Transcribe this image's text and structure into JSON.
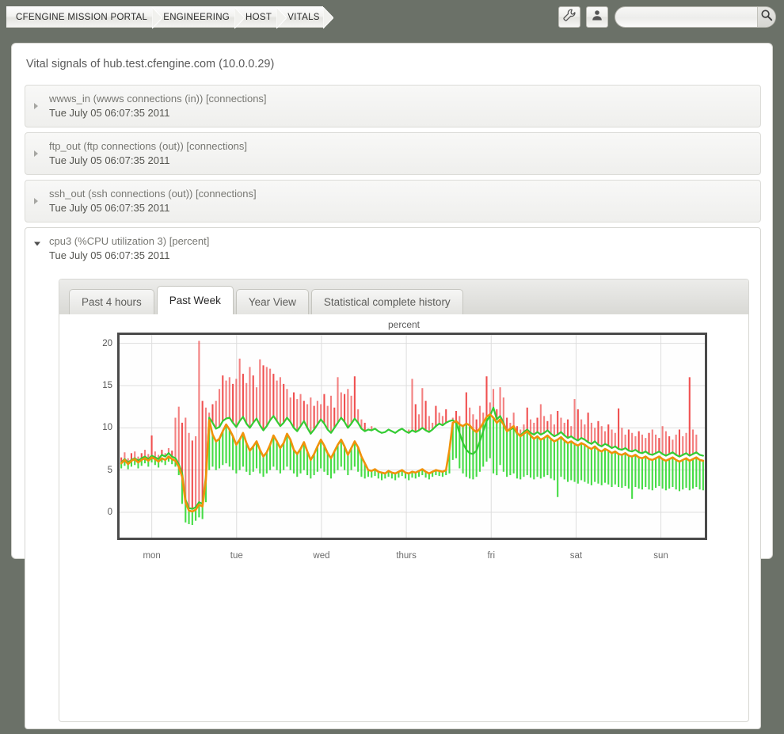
{
  "topbar": {
    "breadcrumb": [
      {
        "label": "CFENGINE MISSION PORTAL"
      },
      {
        "label": "ENGINEERING"
      },
      {
        "label": "HOST"
      },
      {
        "label": "VITALS"
      }
    ],
    "wrench_icon": "wrench-icon",
    "user_icon": "user-icon",
    "search": {
      "value": "",
      "placeholder": "",
      "button_icon": "search-icon"
    }
  },
  "panel": {
    "title": "Vital signals of hub.test.cfengine.com (10.0.0.29)"
  },
  "signals": [
    {
      "name": "wwws_in (wwws connections (in)) [connections]",
      "timestamp": "Tue July 05 06:07:35 2011",
      "expanded": false
    },
    {
      "name": "ftp_out (ftp connections (out)) [connections]",
      "timestamp": "Tue July 05 06:07:35 2011",
      "expanded": false
    },
    {
      "name": "ssh_out (ssh connections (out)) [connections]",
      "timestamp": "Tue July 05 06:07:35 2011",
      "expanded": false
    },
    {
      "name": "cpu3 (%CPU utilization 3) [percent]",
      "timestamp": "Tue July 05 06:07:35 2011",
      "expanded": true
    }
  ],
  "tabs": [
    {
      "label": "Past 4 hours",
      "active": false
    },
    {
      "label": "Past Week",
      "active": true
    },
    {
      "label": "Year View",
      "active": false
    },
    {
      "label": "Statistical complete history",
      "active": false
    }
  ],
  "colors": {
    "background": "#6b7168",
    "panel": "#ffffff",
    "line_value": "#f0920a",
    "line_upper": "#33cc33",
    "bar_max": "#f05050",
    "bar_min": "#3ddb3d",
    "plot_border": "#4a4a4a",
    "grid": "#dddddd"
  },
  "chart_data": {
    "type": "line",
    "title": "percent",
    "xlabel": "",
    "ylabel": "percent",
    "ylim": [
      -3,
      21
    ],
    "yticks": [
      0,
      5,
      10,
      15,
      20
    ],
    "grid": true,
    "legend": "none",
    "xticks": [
      "mon",
      "tue",
      "wed",
      "thurs",
      "fri",
      "sat",
      "sun"
    ],
    "xtick_positions": [
      0.055,
      0.2,
      0.345,
      0.49,
      0.635,
      0.78,
      0.925
    ],
    "n_points": 168,
    "series": [
      {
        "name": "value",
        "color": "#f0920a",
        "style": "line",
        "values": [
          5.8,
          6.2,
          5.7,
          6.1,
          6.3,
          5.9,
          6.2,
          6.4,
          6.1,
          6.5,
          6.3,
          6.0,
          6.4,
          6.2,
          6.6,
          6.3,
          6.1,
          5.4,
          4.2,
          1.2,
          0.2,
          0.1,
          0.3,
          0.9,
          0.7,
          3.8,
          10.9,
          9.2,
          8.4,
          8.7,
          9.6,
          10.4,
          9.8,
          9.0,
          8.0,
          8.6,
          9.4,
          8.2,
          7.3,
          7.8,
          8.4,
          7.4,
          6.6,
          7.1,
          8.0,
          9.1,
          8.4,
          7.6,
          8.2,
          9.3,
          8.6,
          7.4,
          6.9,
          7.5,
          8.3,
          7.2,
          6.2,
          6.9,
          7.8,
          8.6,
          7.9,
          7.0,
          6.4,
          7.2,
          8.0,
          8.6,
          7.8,
          6.8,
          7.6,
          8.4,
          7.7,
          6.6,
          5.8,
          5.0,
          4.9,
          5.1,
          4.8,
          4.7,
          4.6,
          4.9,
          4.7,
          4.6,
          4.8,
          5.0,
          4.7,
          4.6,
          4.8,
          4.7,
          4.9,
          5.1,
          4.8,
          4.6,
          4.8,
          5.0,
          4.9,
          4.8,
          5.0,
          7.4,
          10.6,
          10.8,
          10.4,
          10.2,
          10.5,
          10.3,
          9.8,
          9.5,
          9.9,
          10.6,
          11.3,
          11.6,
          11.2,
          10.6,
          11.0,
          10.4,
          9.6,
          9.9,
          10.2,
          9.4,
          9.0,
          9.3,
          9.6,
          9.1,
          8.7,
          9.0,
          8.6,
          8.8,
          9.1,
          8.7,
          8.4,
          8.6,
          8.9,
          8.5,
          8.2,
          8.4,
          8.1,
          7.9,
          8.2,
          8.0,
          7.7,
          7.5,
          7.8,
          7.4,
          7.2,
          7.5,
          7.3,
          7.0,
          7.2,
          6.9,
          6.8,
          7.0,
          6.7,
          6.6,
          6.8,
          6.5,
          6.4,
          6.6,
          6.3,
          6.2,
          6.4,
          6.6,
          6.3,
          6.1,
          6.3,
          6.5,
          6.2,
          6.0,
          6.2,
          6.4,
          6.1,
          6.3,
          6.5,
          6.2,
          6.1
        ],
        "note": "orange actual value line"
      },
      {
        "name": "upper_envelope",
        "color": "#33cc33",
        "style": "line",
        "values": [
          5.9,
          6.3,
          5.9,
          6.2,
          6.4,
          6.1,
          6.4,
          6.6,
          6.3,
          6.7,
          6.5,
          6.3,
          6.8,
          6.6,
          7.0,
          6.6,
          6.4,
          5.7,
          4.6,
          1.5,
          0.5,
          0.4,
          0.6,
          1.2,
          1.0,
          4.2,
          11.2,
          10.6,
          9.9,
          10.1,
          10.8,
          11.1,
          11.2,
          10.6,
          10.1,
          10.8,
          11.3,
          10.5,
          10.0,
          10.6,
          11.1,
          10.3,
          9.7,
          10.2,
          10.9,
          11.4,
          10.8,
          10.2,
          10.6,
          11.2,
          10.7,
          10.0,
          9.6,
          10.2,
          10.8,
          10.0,
          9.3,
          9.8,
          10.4,
          11.0,
          10.5,
          9.8,
          9.4,
          10.0,
          10.6,
          11.2,
          10.7,
          10.0,
          10.5,
          11.1,
          10.6,
          9.9,
          9.6,
          9.8,
          9.7,
          9.9,
          9.6,
          9.4,
          9.5,
          9.8,
          9.6,
          9.4,
          9.7,
          9.9,
          9.6,
          9.4,
          9.7,
          9.5,
          9.7,
          10.0,
          9.7,
          9.5,
          9.8,
          10.2,
          10.5,
          10.3,
          10.6,
          10.8,
          10.9,
          10.6,
          9.4,
          8.2,
          7.4,
          7.0,
          6.9,
          7.3,
          8.4,
          9.6,
          10.8,
          11.4,
          12.4,
          11.0,
          11.4,
          10.6,
          9.6,
          9.8,
          10.0,
          9.3,
          9.1,
          9.5,
          9.8,
          9.4,
          9.2,
          9.5,
          9.2,
          9.4,
          9.7,
          9.3,
          9.0,
          9.2,
          9.5,
          9.1,
          8.8,
          9.0,
          8.7,
          8.5,
          8.8,
          8.6,
          8.3,
          8.1,
          8.4,
          8.0,
          7.8,
          8.1,
          7.9,
          7.6,
          7.8,
          7.5,
          7.4,
          7.6,
          7.3,
          7.2,
          7.4,
          7.1,
          7.0,
          7.2,
          6.9,
          6.8,
          7.0,
          7.2,
          6.9,
          6.7,
          6.9,
          7.1,
          6.8,
          6.6,
          6.8,
          7.0,
          6.7,
          6.9,
          7.1,
          6.8,
          6.7
        ],
        "note": "green upper envelope line"
      },
      {
        "name": "max_bars",
        "color": "#f05050",
        "style": "vertical-bar",
        "values": [
          6.5,
          7.1,
          6.4,
          7.0,
          7.2,
          6.6,
          7.0,
          7.4,
          6.9,
          9.1,
          7.2,
          6.8,
          7.4,
          7.0,
          7.6,
          7.3,
          11.2,
          12.5,
          10.6,
          11.2,
          9.4,
          8.5,
          9.0,
          20.3,
          13.2,
          12.4,
          11.8,
          12.8,
          13.2,
          14.6,
          16.2,
          15.6,
          16.0,
          15.2,
          15.8,
          18.2,
          16.4,
          15.3,
          17.2,
          16.2,
          14.8,
          18.1,
          17.4,
          17.2,
          17.0,
          16.4,
          15.6,
          16.0,
          15.2,
          14.6,
          13.6,
          14.2,
          13.4,
          14.0,
          13.2,
          12.8,
          13.6,
          12.6,
          13.2,
          12.8,
          14.0,
          12.6,
          13.8,
          12.4,
          16.0,
          14.2,
          14.0,
          14.6,
          13.8,
          16.1,
          12.2,
          11.0,
          10.6,
          9.8,
          10.2,
          9.4,
          8.6,
          9.2,
          8.4,
          9.6,
          9.0,
          8.2,
          8.8,
          9.4,
          8.6,
          9.8,
          15.8,
          12.8,
          11.6,
          14.7,
          13.2,
          11.4,
          10.6,
          12.6,
          11.8,
          11.4,
          12.2,
          10.8,
          11.2,
          12.0,
          11.4,
          10.2,
          14.2,
          12.4,
          11.6,
          11.0,
          12.6,
          11.8,
          16.1,
          13.0,
          14.6,
          12.2,
          14.8,
          13.6,
          11.2,
          10.6,
          11.8,
          10.2,
          9.8,
          10.4,
          12.4,
          11.0,
          10.6,
          11.2,
          12.8,
          11.4,
          10.8,
          11.6,
          10.4,
          12.0,
          11.2,
          10.6,
          11.0,
          10.2,
          13.4,
          12.2,
          11.0,
          10.4,
          11.8,
          10.6,
          10.0,
          10.8,
          10.2,
          9.6,
          10.4,
          9.8,
          9.4,
          12.3,
          10.0,
          9.2,
          9.8,
          9.4,
          9.0,
          9.6,
          9.2,
          8.8,
          9.4,
          9.8,
          9.2,
          8.8,
          10.2,
          9.6,
          9.0,
          8.6,
          9.2,
          9.8,
          9.0,
          9.4,
          16.0,
          9.8,
          9.2
        ],
        "note": "red bars rising above the envelope = max samples"
      },
      {
        "name": "min_bars",
        "color": "#3ddb3d",
        "style": "vertical-bar",
        "values": [
          5.2,
          5.5,
          5.1,
          5.4,
          5.6,
          5.2,
          5.5,
          5.8,
          5.4,
          5.9,
          5.6,
          5.3,
          5.9,
          5.6,
          6.0,
          5.7,
          5.4,
          4.4,
          1.0,
          -1.2,
          -1.4,
          -1.5,
          -1.0,
          -0.6,
          -0.8,
          1.2,
          5.0,
          5.4,
          5.0,
          5.2,
          5.6,
          5.8,
          5.4,
          5.0,
          4.6,
          5.0,
          5.4,
          4.8,
          4.4,
          4.8,
          5.2,
          4.6,
          4.2,
          4.6,
          5.0,
          5.4,
          5.0,
          4.6,
          5.0,
          5.4,
          5.0,
          4.6,
          4.2,
          4.6,
          5.0,
          4.4,
          4.0,
          4.4,
          4.8,
          5.2,
          4.8,
          4.4,
          4.0,
          4.6,
          5.0,
          5.4,
          5.0,
          4.4,
          5.0,
          5.4,
          4.8,
          4.2,
          4.0,
          4.2,
          4.1,
          4.3,
          4.0,
          3.8,
          4.0,
          4.2,
          4.0,
          3.8,
          4.1,
          4.3,
          4.0,
          3.8,
          4.1,
          4.0,
          4.2,
          4.4,
          4.1,
          3.9,
          4.2,
          4.4,
          4.3,
          4.2,
          4.4,
          4.6,
          6.2,
          6.4,
          5.2,
          4.6,
          4.2,
          4.0,
          3.9,
          4.2,
          4.8,
          5.4,
          6.0,
          6.4,
          4.6,
          4.4,
          5.6,
          4.8,
          4.2,
          4.4,
          4.6,
          4.0,
          3.9,
          4.2,
          4.4,
          4.1,
          3.9,
          4.2,
          4.0,
          4.2,
          4.4,
          4.0,
          3.8,
          1.8,
          4.2,
          3.9,
          3.6,
          3.8,
          3.6,
          3.4,
          3.8,
          3.6,
          3.4,
          3.2,
          3.6,
          3.4,
          3.2,
          3.5,
          3.3,
          3.0,
          3.3,
          3.0,
          2.9,
          3.1,
          2.8,
          1.6,
          3.0,
          2.8,
          2.7,
          3.0,
          2.7,
          2.6,
          2.9,
          3.1,
          2.8,
          2.6,
          2.8,
          3.0,
          2.7,
          2.5,
          2.7,
          2.9,
          2.6,
          2.8,
          3.0,
          2.7,
          2.6
        ],
        "note": "green bars descending below the envelope = min samples"
      }
    ]
  }
}
